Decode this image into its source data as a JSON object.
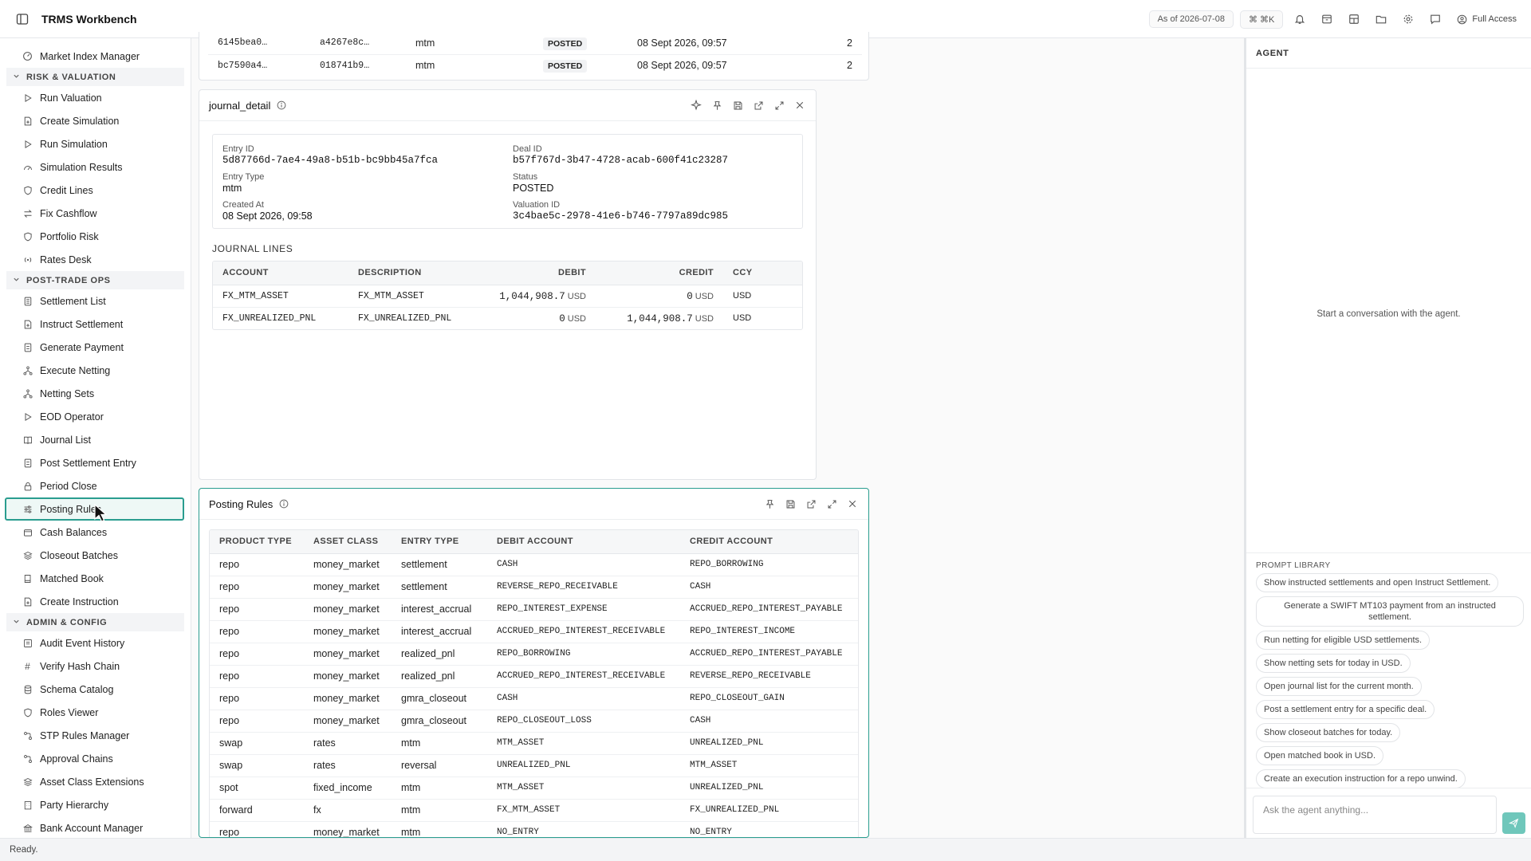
{
  "app": {
    "title": "TRMS Workbench"
  },
  "topbar": {
    "as_of": "As of 2026-07-08",
    "shortcut": "⌘ ⌘K",
    "access_label": "Full Access"
  },
  "sidebar": {
    "top_item": "Market Index Manager",
    "sections": [
      {
        "title": "RISK & VALUATION",
        "items": [
          "Run Valuation",
          "Create Simulation",
          "Run Simulation",
          "Simulation Results",
          "Credit Lines",
          "Fix Cashflow",
          "Portfolio Risk",
          "Rates Desk"
        ]
      },
      {
        "title": "POST-TRADE OPS",
        "items": [
          "Settlement List",
          "Instruct Settlement",
          "Generate Payment",
          "Execute Netting",
          "Netting Sets",
          "EOD Operator",
          "Journal List",
          "Post Settlement Entry",
          "Period Close",
          "Posting Rules",
          "Cash Balances",
          "Closeout Batches",
          "Matched Book",
          "Create Instruction"
        ]
      },
      {
        "title": "ADMIN & CONFIG",
        "items": [
          "Audit Event History",
          "Verify Hash Chain",
          "Schema Catalog",
          "Roles Viewer",
          "STP Rules Manager",
          "Approval Chains",
          "Asset Class Extensions",
          "Party Hierarchy",
          "Bank Account Manager"
        ]
      }
    ],
    "active_item": "Posting Rules"
  },
  "journal_list_partial": {
    "rows": [
      {
        "entry": "6145bea0…",
        "deal": "a4267e8c…",
        "type": "mtm",
        "status": "POSTED",
        "created": "08 Sept 2026, 09:57",
        "lines": "2"
      },
      {
        "entry": "bc7590a4…",
        "deal": "018741b9…",
        "type": "mtm",
        "status": "POSTED",
        "created": "08 Sept 2026, 09:57",
        "lines": "2"
      }
    ]
  },
  "journal_detail": {
    "title": "journal_detail",
    "fields": {
      "entry_id_label": "Entry ID",
      "entry_id": "5d87766d-7ae4-49a8-b51b-bc9bb45a7fca",
      "deal_id_label": "Deal ID",
      "deal_id": "b57f767d-3b47-4728-acab-600f41c23287",
      "entry_type_label": "Entry Type",
      "entry_type": "mtm",
      "status_label": "Status",
      "status": "POSTED",
      "created_at_label": "Created At",
      "created_at": "08 Sept 2026, 09:58",
      "valuation_id_label": "Valuation ID",
      "valuation_id": "3c4bae5c-2978-41e6-b746-7797a89dc985"
    },
    "lines_heading": "JOURNAL LINES",
    "columns": [
      "ACCOUNT",
      "DESCRIPTION",
      "DEBIT",
      "CREDIT",
      "CCY"
    ],
    "lines": [
      {
        "account": "FX_MTM_ASSET",
        "description": "FX_MTM_ASSET",
        "debit": "1,044,908.7",
        "debit_ccy": "USD",
        "credit": "0",
        "credit_ccy": "USD",
        "ccy": "USD"
      },
      {
        "account": "FX_UNREALIZED_PNL",
        "description": "FX_UNREALIZED_PNL",
        "debit": "0",
        "debit_ccy": "USD",
        "credit": "1,044,908.7",
        "credit_ccy": "USD",
        "ccy": "USD"
      }
    ]
  },
  "posting_rules": {
    "title": "Posting Rules",
    "columns": [
      "PRODUCT TYPE",
      "ASSET CLASS",
      "ENTRY TYPE",
      "DEBIT ACCOUNT",
      "CREDIT ACCOUNT"
    ],
    "rows": [
      [
        "repo",
        "money_market",
        "settlement",
        "CASH",
        "REPO_BORROWING"
      ],
      [
        "repo",
        "money_market",
        "settlement",
        "REVERSE_REPO_RECEIVABLE",
        "CASH"
      ],
      [
        "repo",
        "money_market",
        "interest_accrual",
        "REPO_INTEREST_EXPENSE",
        "ACCRUED_REPO_INTEREST_PAYABLE"
      ],
      [
        "repo",
        "money_market",
        "interest_accrual",
        "ACCRUED_REPO_INTEREST_RECEIVABLE",
        "REPO_INTEREST_INCOME"
      ],
      [
        "repo",
        "money_market",
        "realized_pnl",
        "REPO_BORROWING",
        "ACCRUED_REPO_INTEREST_PAYABLE"
      ],
      [
        "repo",
        "money_market",
        "realized_pnl",
        "ACCRUED_REPO_INTEREST_RECEIVABLE",
        "REVERSE_REPO_RECEIVABLE"
      ],
      [
        "repo",
        "money_market",
        "gmra_closeout",
        "CASH",
        "REPO_CLOSEOUT_GAIN"
      ],
      [
        "repo",
        "money_market",
        "gmra_closeout",
        "REPO_CLOSEOUT_LOSS",
        "CASH"
      ],
      [
        "swap",
        "rates",
        "mtm",
        "MTM_ASSET",
        "UNREALIZED_PNL"
      ],
      [
        "swap",
        "rates",
        "reversal",
        "UNREALIZED_PNL",
        "MTM_ASSET"
      ],
      [
        "spot",
        "fixed_income",
        "mtm",
        "MTM_ASSET",
        "UNREALIZED_PNL"
      ],
      [
        "forward",
        "fx",
        "mtm",
        "FX_MTM_ASSET",
        "FX_UNREALIZED_PNL"
      ],
      [
        "repo",
        "money_market",
        "mtm",
        "NO_ENTRY",
        "NO_ENTRY"
      ]
    ]
  },
  "agent": {
    "title": "AGENT",
    "empty_text": "Start a conversation with the agent.",
    "prompt_library_title": "PROMPT LIBRARY",
    "prompts": [
      "Show instructed settlements and open Instruct Settlement.",
      "Generate a SWIFT MT103 payment from an instructed settlement.",
      "Run netting for eligible USD settlements.",
      "Show netting sets for today in USD.",
      "Open journal list for the current month.",
      "Post a settlement entry for a specific deal.",
      "Show closeout batches for today.",
      "Open matched book in USD.",
      "Create an execution instruction for a repo unwind."
    ],
    "input_placeholder": "Ask the agent anything..."
  },
  "status": {
    "text": "Ready."
  },
  "colors": {
    "accent": "#2a9d8f",
    "send": "#6fc7bb"
  }
}
